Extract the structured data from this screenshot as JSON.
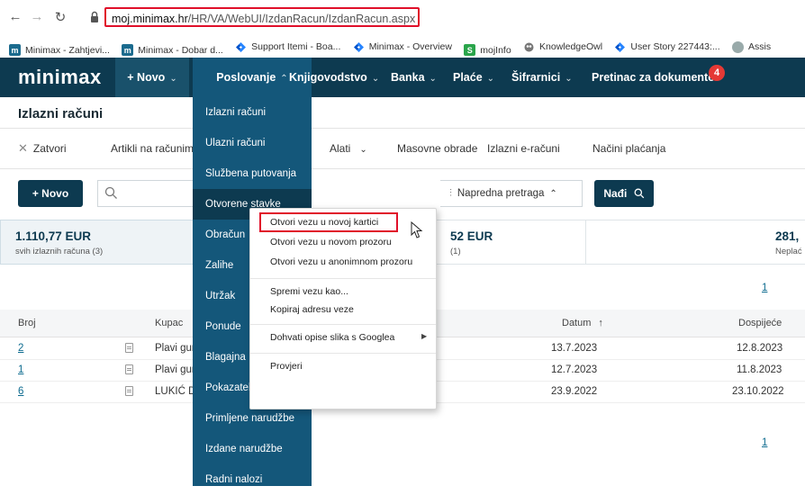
{
  "browser": {
    "url_host": "moj.minimax.hr",
    "url_path": "/HR/VA/WebUI/IzdanRacun/IzdanRacun.aspx",
    "bookmarks": [
      {
        "icon": "m-icon",
        "label": "Minimax - Zahtjevi..."
      },
      {
        "icon": "m-icon",
        "label": "Minimax - Dobar d..."
      },
      {
        "icon": "jira-icon",
        "label": "Support Itemi - Boa..."
      },
      {
        "icon": "jira-icon",
        "label": "Minimax - Overview"
      },
      {
        "icon": "s-icon",
        "label": "mojInfo"
      },
      {
        "icon": "knowledgeowl-icon",
        "label": "KnowledgeOwl"
      },
      {
        "icon": "jira-icon",
        "label": "User Story 227443:..."
      },
      {
        "icon": "chatgpt-icon",
        "label": "Assis"
      }
    ]
  },
  "app": {
    "logo": "minimax",
    "nav": {
      "novo": "+ Novo",
      "poslovanje": "Poslovanje",
      "knjigovodstvo": "Knjigovodstvo",
      "banka": "Banka",
      "place": "Plaće",
      "sifrarnici": "Šifrarnici",
      "pretinac": "Pretinac za dokumente",
      "pretinac_badge": "4"
    }
  },
  "page": {
    "title": "Izlazni računi",
    "toolbar": {
      "zatvori": "Zatvori",
      "artikli": "Artikli na računima",
      "alati": "Alati",
      "masovne": "Masovne obrade",
      "e_racuni": "Izlazni e-računi",
      "nacini": "Načini plaćanja"
    },
    "novo_button": "+ Novo",
    "search_placeholder": "",
    "advanced_search": "Napredna pretraga",
    "nadji_button": "Nađi",
    "cards": [
      {
        "amount": "1.110,77 EUR",
        "label": "svih izlaznih računa (3)"
      },
      {
        "amount": "52 EUR",
        "label": "(1)"
      },
      {
        "amount": "281,",
        "label": "Neplać"
      }
    ],
    "pager_top": "1",
    "pager_bottom": "1"
  },
  "table": {
    "headers": {
      "broj": "Broj",
      "kupac": "Kupac",
      "datum": "Datum",
      "dospijece": "Dospijeće"
    },
    "rows": [
      {
        "broj": "2",
        "kupac": "Plavi gur",
        "datum": "13.7.2023",
        "dospijece": "12.8.2023"
      },
      {
        "broj": "1",
        "kupac": "Plavi gur",
        "datum": "12.7.2023",
        "dospijece": "11.8.2023"
      },
      {
        "broj": "6",
        "kupac": "LUKIĆ D",
        "datum": "23.9.2022",
        "dospijece": "23.10.2022"
      }
    ]
  },
  "dropdown": {
    "items": [
      "Izlazni računi",
      "Ulazni računi",
      "Službena putovanja",
      "Otvorene stavke",
      "Obračun",
      "Zalihe",
      "Utržak",
      "Ponude",
      "Blagajna",
      "Pokazatelji",
      "Primljene narudžbe",
      "Izdane narudžbe",
      "Radni nalozi"
    ]
  },
  "context_menu": {
    "open_new_tab": "Otvori vezu u novoj kartici",
    "open_new_window": "Otvori vezu u novom prozoru",
    "open_incognito": "Otvori vezu u anonimnom prozoru",
    "save_link": "Spremi vezu kao...",
    "copy_link": "Kopiraj adresu veze",
    "google_images": "Dohvati opise slika s Googlea",
    "inspect": "Provjeri"
  },
  "colors": {
    "navy": "#0d3a50",
    "menu_blue": "#14577a",
    "highlight_red": "#e0102a",
    "badge_red": "#e53935",
    "link_blue": "#0d6b8f"
  }
}
